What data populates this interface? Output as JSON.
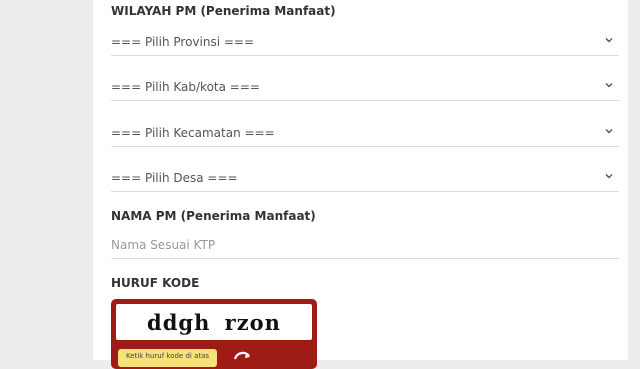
{
  "form": {
    "wilayah_label": "WILAYAH PM (Penerima Manfaat)",
    "selects": [
      {
        "value": "=== Pilih Provinsi ==="
      },
      {
        "value": "=== Pilih Kab/kota ==="
      },
      {
        "value": "=== Pilih Kecamatan ==="
      },
      {
        "value": "=== Pilih Desa ==="
      }
    ],
    "nama_label": "NAMA PM (Penerima Manfaat)",
    "nama_placeholder": "Nama Sesuai KTP",
    "huruf_kode_label": "HURUF KODE"
  },
  "captcha": {
    "text": "ddgh rzon",
    "hint": "Ketik huruf kode di atas",
    "refresh_icon": "refresh-icon"
  },
  "colors": {
    "page_bg": "#ededed",
    "panel_bg": "#ffffff",
    "captcha_frame": "#9e1b16",
    "captcha_hint_bg": "#f6e27a"
  }
}
